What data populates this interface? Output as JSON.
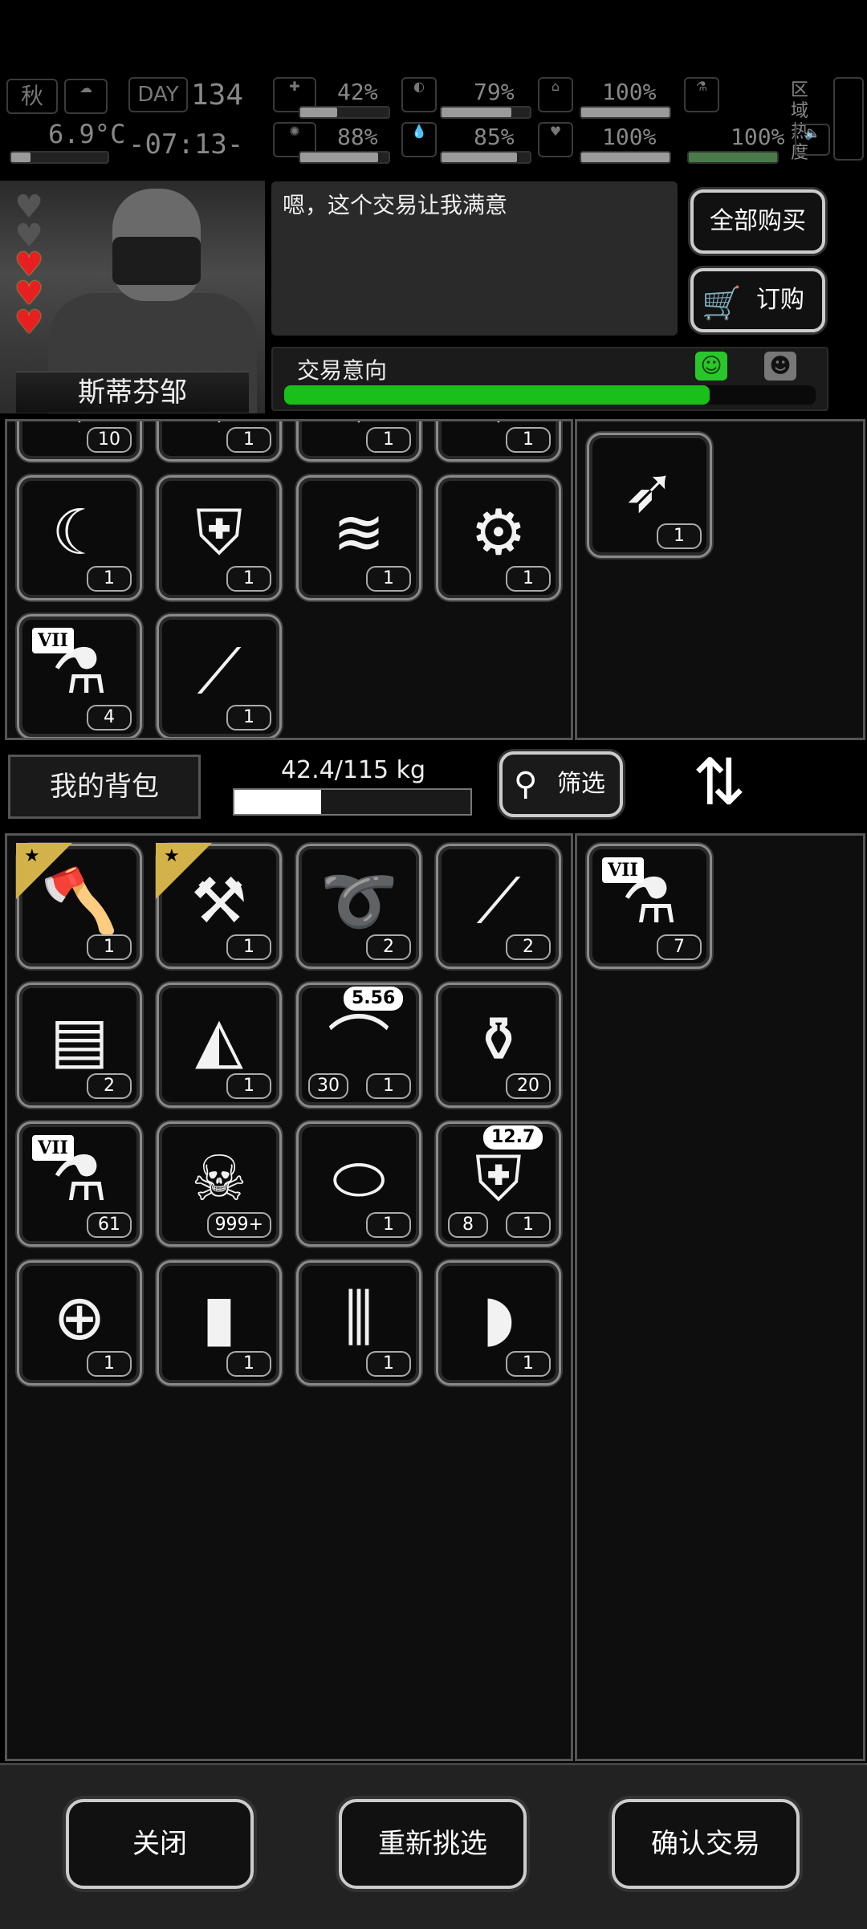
{
  "hud": {
    "season": "秋",
    "day_label": "DAY",
    "day": "134",
    "temperature": "6.9°C",
    "time": "-07:13-",
    "stats": [
      "42%",
      "79%",
      "100%",
      "88%",
      "85%",
      "100%",
      "100%"
    ],
    "stat_levels": [
      0.42,
      0.79,
      1.0,
      0.88,
      0.85,
      1.0,
      1.0
    ],
    "zone_heat_label": "区域热度"
  },
  "merchant": {
    "name": "斯蒂芬邹",
    "hearts_total": 5,
    "hearts_filled": 3,
    "dialog": "嗯，这个交易让我满意",
    "intent_label": "交易意向",
    "intent_level": 0.8,
    "buy_all_label": "全部购买",
    "order_label": "订购"
  },
  "merchant_grid": [
    {
      "name": "merchant-item",
      "count": "10"
    },
    {
      "name": "merchant-item",
      "count": "1"
    },
    {
      "name": "merchant-item",
      "count": "1"
    },
    {
      "name": "merchant-item",
      "count": "1"
    },
    {
      "name": "sickle-icon",
      "count": "1"
    },
    {
      "name": "armor-vest-icon",
      "count": "1"
    },
    {
      "name": "claw-icon",
      "count": "1"
    },
    {
      "name": "minigun-icon",
      "count": "1"
    },
    {
      "name": "test-tube-icon",
      "count": "4",
      "tier": "VII"
    },
    {
      "name": "sniper-rifle-icon",
      "count": "1"
    }
  ],
  "trade_merchant": [
    {
      "name": "rocket-launcher-icon",
      "count": "1"
    }
  ],
  "backpack": {
    "label": "我的背包",
    "weight_text": "42.4/115 kg",
    "weight_level": 0.368,
    "filter_label": "筛选"
  },
  "backpack_grid": [
    {
      "name": "axe-icon",
      "count": "1",
      "star": true
    },
    {
      "name": "shovel-icon",
      "count": "1",
      "star": true
    },
    {
      "name": "rope-icon",
      "count": "2"
    },
    {
      "name": "tweezers-icon",
      "count": "2"
    },
    {
      "name": "towel-icon",
      "count": "2"
    },
    {
      "name": "cloth-scrap-icon",
      "count": "1"
    },
    {
      "name": "magazine-icon",
      "count": "1",
      "caliber": "5.56",
      "rounds": "30"
    },
    {
      "name": "bottle-icon",
      "count": "20"
    },
    {
      "name": "test-tube-icon",
      "count": "61",
      "tier": "VII"
    },
    {
      "name": "zombie-poster-icon",
      "count": "999+"
    },
    {
      "name": "canned-food-icon",
      "count": "1"
    },
    {
      "name": "armor-vest-icon",
      "count": "1",
      "caliber": "12.7",
      "rounds": "8"
    },
    {
      "name": "scope-icon",
      "count": "1"
    },
    {
      "name": "grip-icon",
      "count": "1"
    },
    {
      "name": "suppressor-icon",
      "count": "1"
    },
    {
      "name": "bread-icon",
      "count": "1"
    }
  ],
  "trade_player": [
    {
      "name": "test-tube-icon",
      "count": "7",
      "tier": "VII"
    }
  ],
  "actions": {
    "close": "关闭",
    "reselect": "重新挑选",
    "confirm": "确认交易"
  }
}
